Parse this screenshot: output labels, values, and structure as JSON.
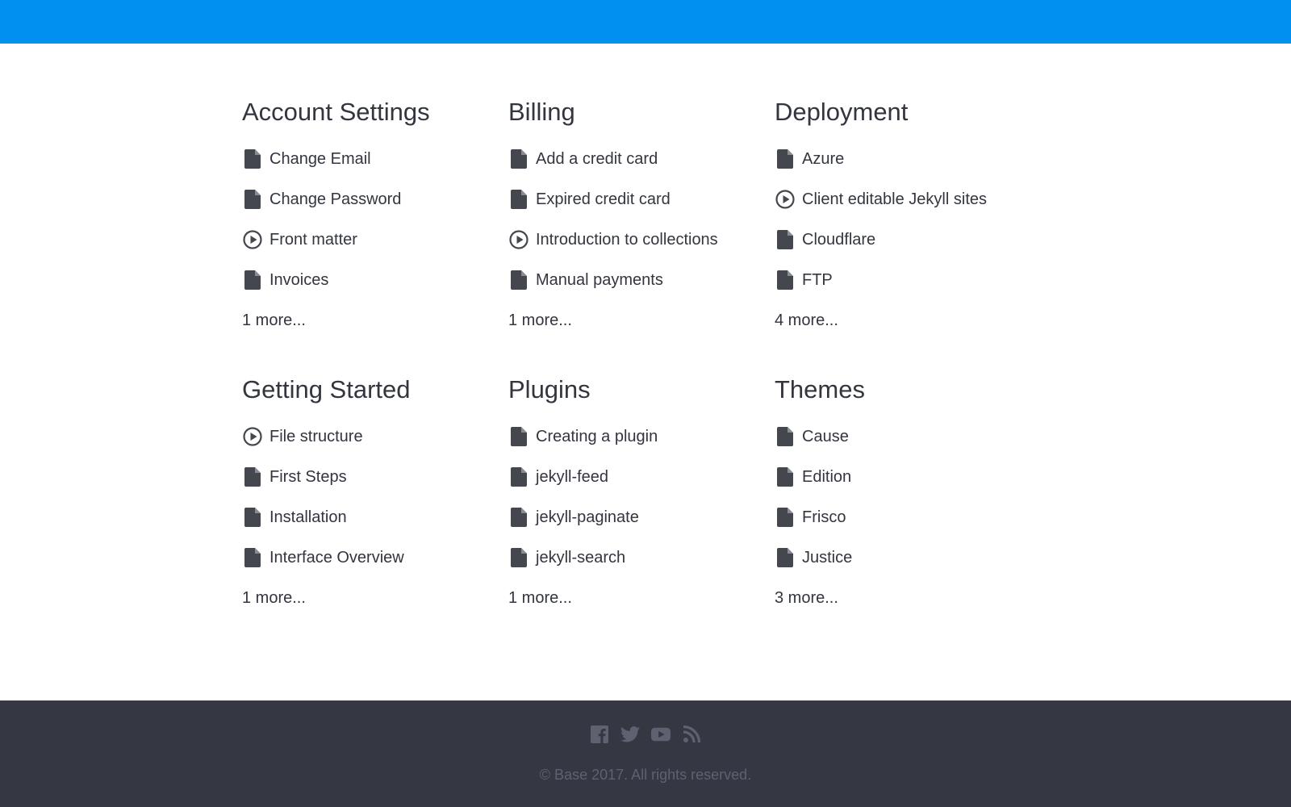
{
  "theme": {
    "accent": "#0190f0",
    "text": "#33353f",
    "footer_bg": "#353743",
    "footer_text": "#5f6170",
    "icon_color": "#45474f"
  },
  "categories": [
    {
      "title": "Account Settings",
      "items": [
        {
          "label": "Change Email",
          "icon": "document-icon"
        },
        {
          "label": "Change Password",
          "icon": "document-icon"
        },
        {
          "label": "Front matter",
          "icon": "play-circle-icon"
        },
        {
          "label": "Invoices",
          "icon": "document-icon"
        }
      ],
      "more": "1 more..."
    },
    {
      "title": "Billing",
      "items": [
        {
          "label": "Add a credit card",
          "icon": "document-icon"
        },
        {
          "label": "Expired credit card",
          "icon": "document-icon"
        },
        {
          "label": "Introduction to collections",
          "icon": "play-circle-icon"
        },
        {
          "label": "Manual payments",
          "icon": "document-icon"
        }
      ],
      "more": "1 more..."
    },
    {
      "title": "Deployment",
      "items": [
        {
          "label": "Azure",
          "icon": "document-icon"
        },
        {
          "label": "Client editable Jekyll sites",
          "icon": "play-circle-icon"
        },
        {
          "label": "Cloudflare",
          "icon": "document-icon"
        },
        {
          "label": "FTP",
          "icon": "document-icon"
        }
      ],
      "more": "4 more..."
    },
    {
      "title": "Getting Started",
      "items": [
        {
          "label": "File structure",
          "icon": "play-circle-icon"
        },
        {
          "label": "First Steps",
          "icon": "document-icon"
        },
        {
          "label": "Installation",
          "icon": "document-icon"
        },
        {
          "label": "Interface Overview",
          "icon": "document-icon"
        }
      ],
      "more": "1 more..."
    },
    {
      "title": "Plugins",
      "items": [
        {
          "label": "Creating a plugin",
          "icon": "document-icon"
        },
        {
          "label": "jekyll-feed",
          "icon": "document-icon"
        },
        {
          "label": "jekyll-paginate",
          "icon": "document-icon"
        },
        {
          "label": "jekyll-search",
          "icon": "document-icon"
        }
      ],
      "more": "1 more..."
    },
    {
      "title": "Themes",
      "items": [
        {
          "label": "Cause",
          "icon": "document-icon"
        },
        {
          "label": "Edition",
          "icon": "document-icon"
        },
        {
          "label": "Frisco",
          "icon": "document-icon"
        },
        {
          "label": "Justice",
          "icon": "document-icon"
        }
      ],
      "more": "3 more..."
    }
  ],
  "footer": {
    "social": [
      "facebook-icon",
      "twitter-icon",
      "youtube-icon",
      "rss-icon"
    ],
    "copyright": "© Base 2017. All rights reserved."
  }
}
